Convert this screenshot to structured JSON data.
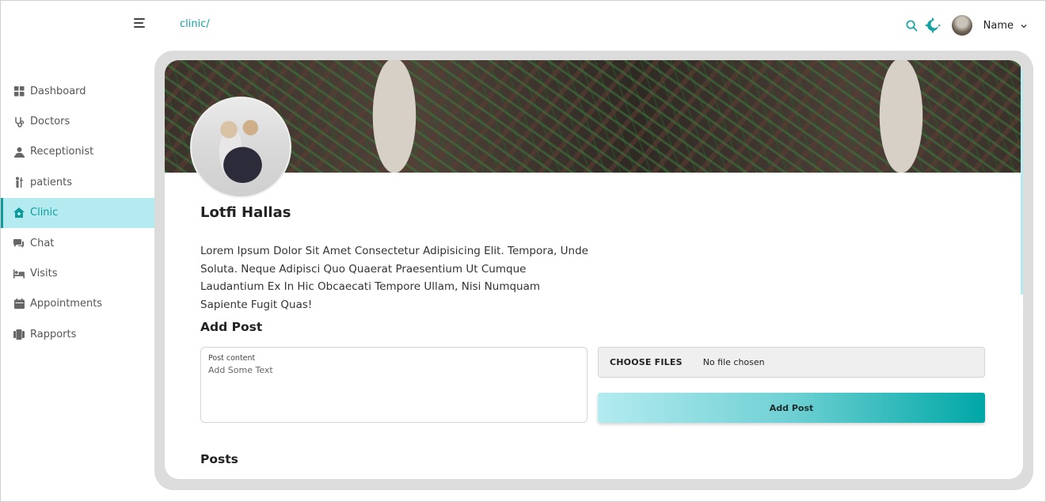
{
  "header": {
    "breadcrumb": "clinic/",
    "user_name": "Name"
  },
  "sidebar": {
    "items": [
      {
        "label": "Dashboard",
        "icon": "grid-icon"
      },
      {
        "label": "Doctors",
        "icon": "stethoscope-icon"
      },
      {
        "label": "Receptionist",
        "icon": "receptionist-icon"
      },
      {
        "label": "patients",
        "icon": "patient-icon"
      },
      {
        "label": "Clinic",
        "icon": "home-icon",
        "active": true
      },
      {
        "label": "Chat",
        "icon": "chat-icon"
      },
      {
        "label": "Visits",
        "icon": "bed-icon"
      },
      {
        "label": "Appointments",
        "icon": "calendar-icon"
      },
      {
        "label": "Rapports",
        "icon": "report-icon"
      }
    ]
  },
  "profile": {
    "name": "Lotfi Hallas",
    "bio": "Lorem Ipsum Dolor Sit Amet Consectetur Adipisicing Elit. Tempora, Unde Soluta. Neque Adipisci Quo Quaerat Praesentium Ut Cumque Laudantium Ex In Hic Obcaecati Tempore Ullam, Nisi Numquam Sapiente Fugit Quas!"
  },
  "add_post": {
    "title": "Add Post",
    "content_label": "Post content",
    "content_placeholder": "Add Some Text",
    "choose_files_label": "CHOOSE FILES",
    "file_status": "No file chosen",
    "submit_label": "Add Post"
  },
  "posts": {
    "title": "Posts"
  },
  "colors": {
    "accent": "#14a3a3",
    "active_bg": "#b3ebf0",
    "gradient_start": "#b3ebf0",
    "gradient_end": "#00a7a6"
  }
}
